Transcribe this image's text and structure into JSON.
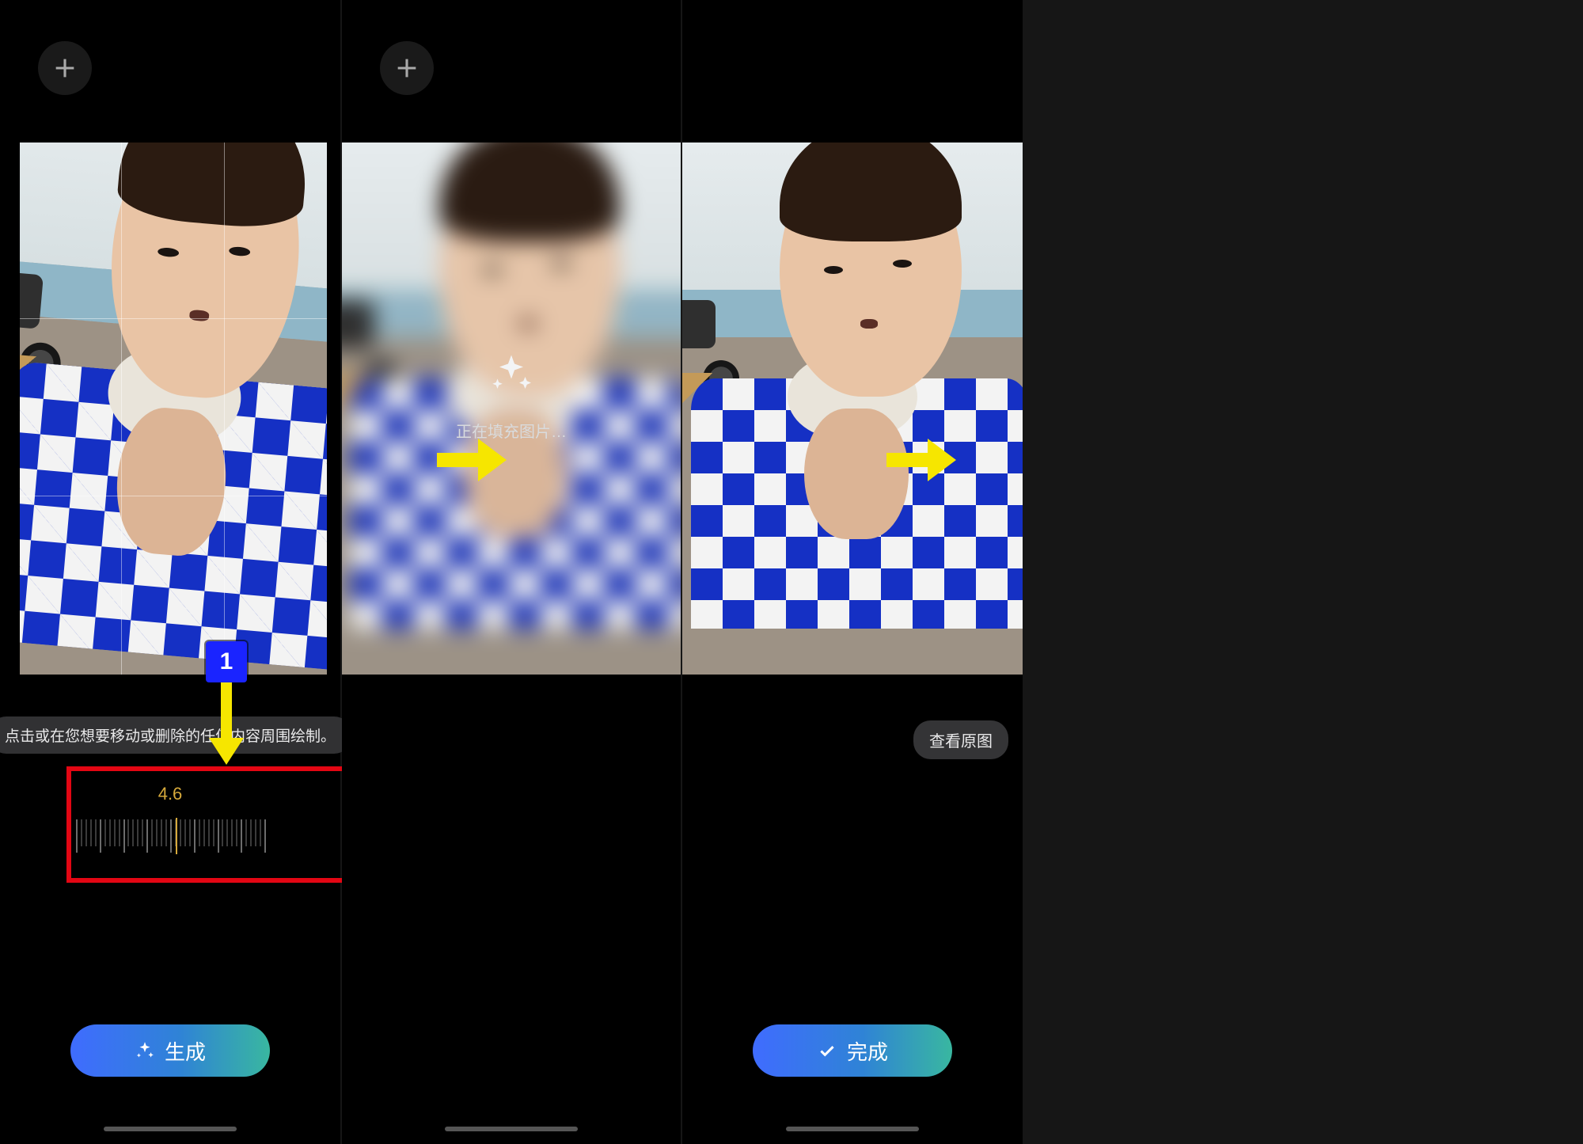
{
  "panel1": {
    "hint": "点击或在您想要移动或删除的任何内容周围绘制。",
    "rotation_value": "4.6",
    "generate_label": "生成",
    "add_icon": "plus-icon",
    "step_badge": "1"
  },
  "panel2": {
    "loading_text": "正在填充图片…",
    "add_icon": "plus-icon"
  },
  "panel3": {
    "done_label": "完成",
    "view_original_label": "查看原图"
  },
  "colors": {
    "accent_yellow": "#d6a93b",
    "annotation_red": "#e30613",
    "annotation_blue": "#1a24ff",
    "arrow_yellow": "#f6e600",
    "pill_gradient_from": "#3f6cff",
    "pill_gradient_to": "#39b7a0"
  }
}
